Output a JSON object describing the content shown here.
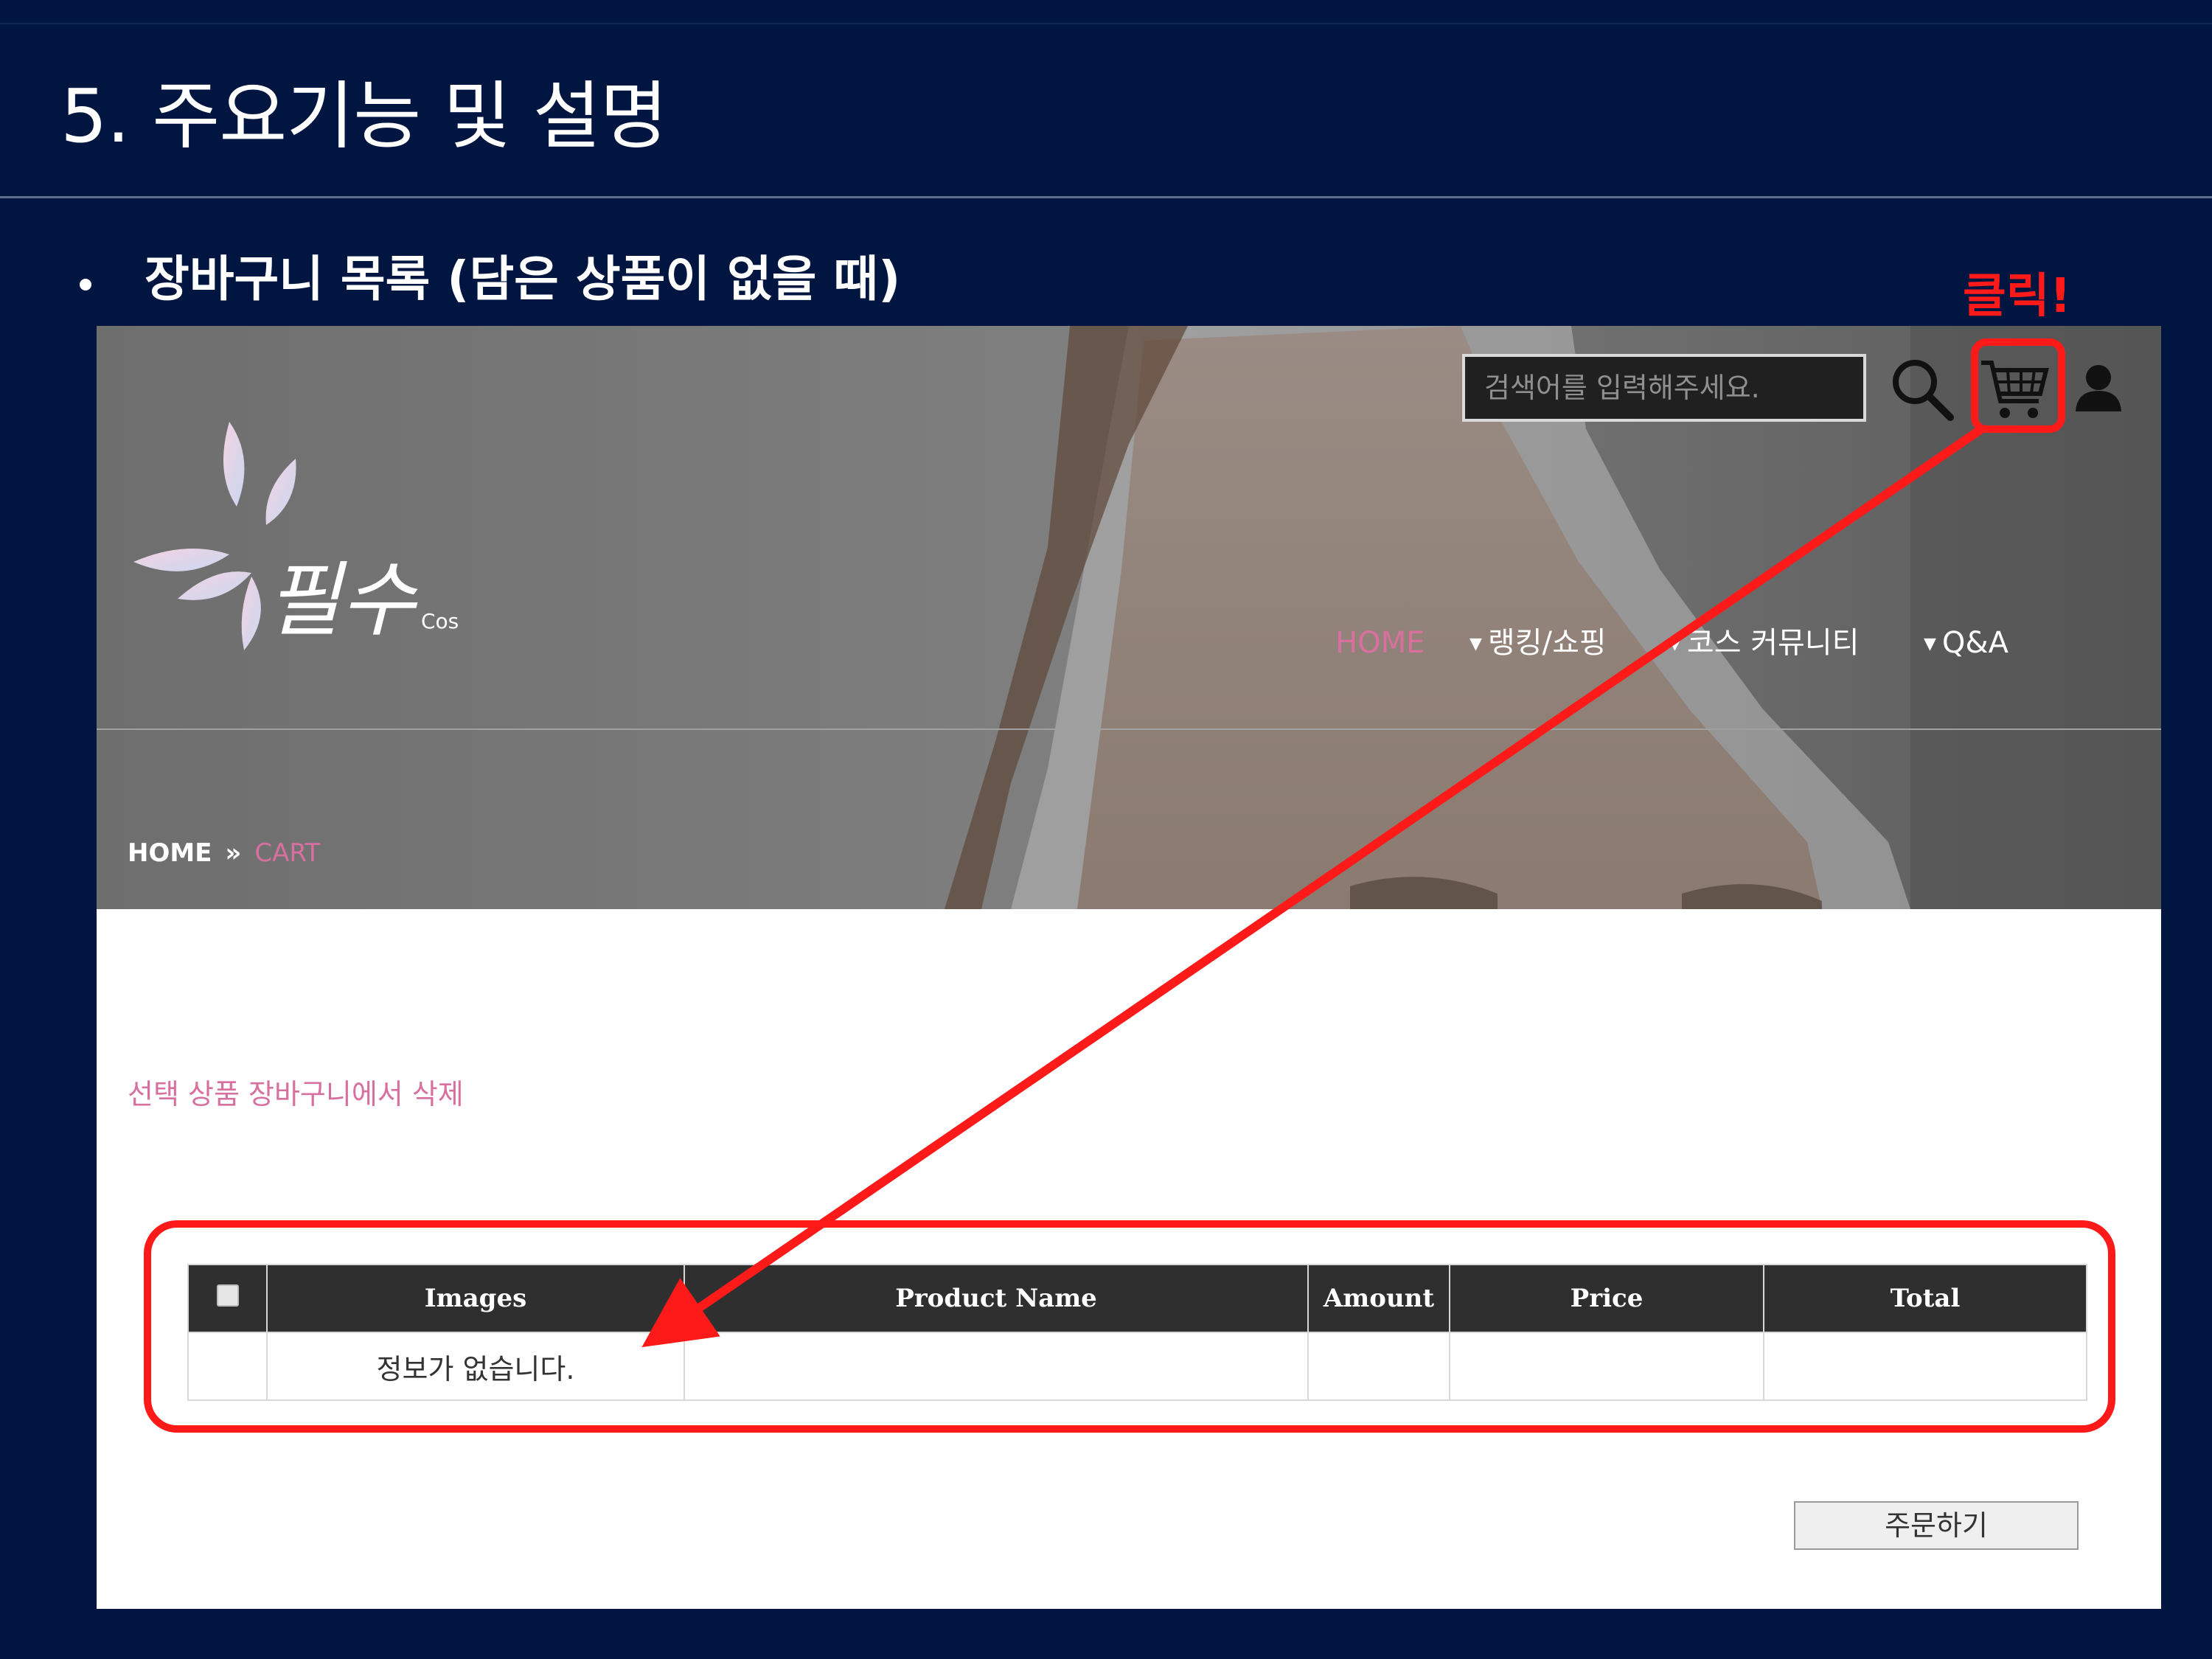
{
  "slide": {
    "title": "5. 주요기능 및 설명",
    "bullet": "장바구니 목록 (담은 상품이 없을 때)",
    "annotation_label": "클릭!"
  },
  "site": {
    "logo_text": "필수",
    "logo_sub": "Cos",
    "search_placeholder": "검색어를 입력해주세요.",
    "icons": [
      "search-icon",
      "cart-icon",
      "user-icon"
    ],
    "nav": {
      "home": "HOME",
      "ranking": "랭킹/쇼핑",
      "course": "코스 커뮤니티",
      "qa": "Q&A"
    },
    "breadcrumb": {
      "home": "HOME",
      "separator": "»",
      "current": "CART"
    },
    "delete_selected": "선택 상품 장바구니에서 삭제",
    "table": {
      "headers": [
        "",
        "Images",
        "Product Name",
        "Amount",
        "Price",
        "Total"
      ],
      "empty_message": "정보가 없습니다."
    },
    "order_button": "주문하기"
  },
  "colors": {
    "slide_background": "#001640",
    "annotation_red": "#ff1a1a",
    "accent_pink": "#d8709f",
    "table_header": "#2f2f2f"
  }
}
